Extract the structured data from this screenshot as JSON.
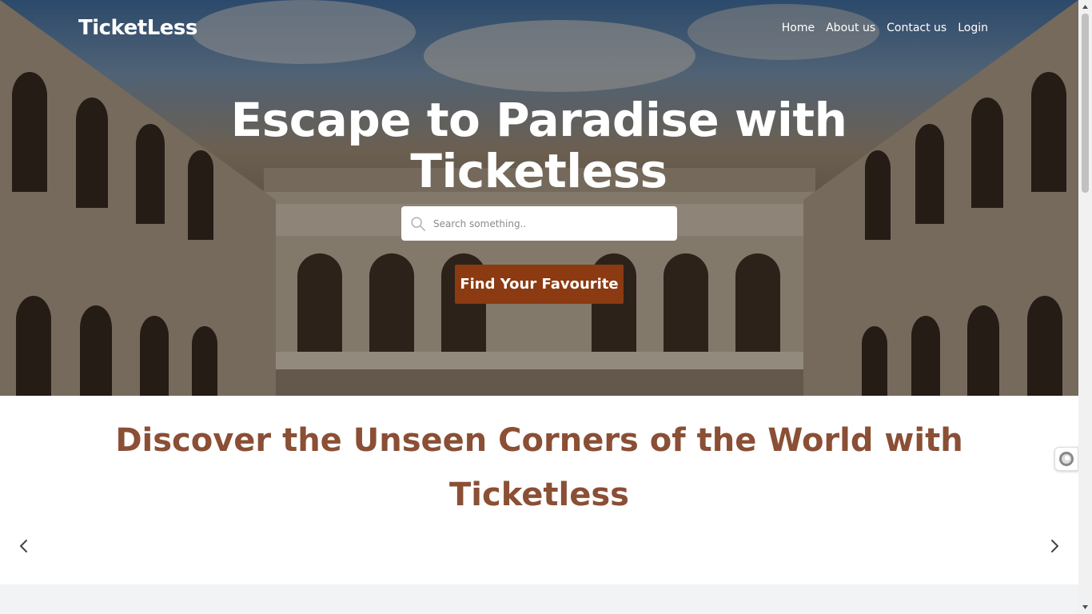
{
  "header": {
    "brand": "TicketLess",
    "nav": [
      {
        "label": "Home"
      },
      {
        "label": "About us"
      },
      {
        "label": "Contact us"
      },
      {
        "label": "Login"
      }
    ]
  },
  "hero": {
    "title": "Escape to Paradise with Ticketless",
    "search_placeholder": "Search something..",
    "cta_label": "Find Your Favourite"
  },
  "discover": {
    "title": "Discover the Unseen Corners of the World with Ticketless"
  },
  "colors": {
    "accent": "#8b3a12",
    "heading_brown": "#8a4f35",
    "band_gray": "#f2f3f5"
  },
  "icons": {
    "search": "search-icon",
    "prev": "chevron-left-icon",
    "next": "chevron-right-icon",
    "widget": "accessibility-widget-icon"
  }
}
